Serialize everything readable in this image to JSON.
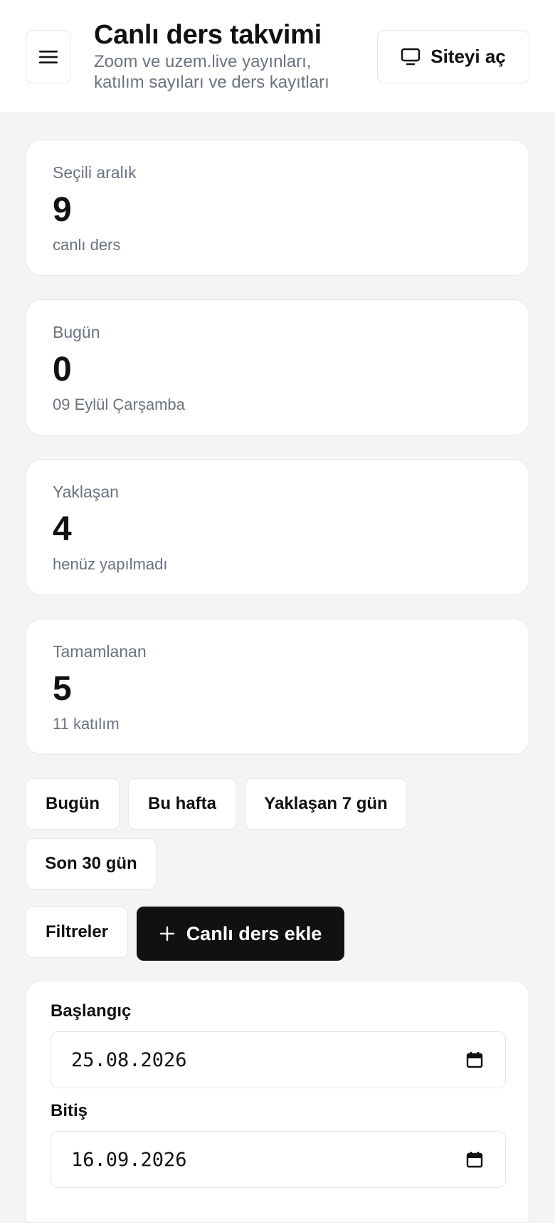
{
  "header": {
    "title": "Canlı ders takvimi",
    "subtitle": "Zoom ve uzem.live yayınları, katılım sayıları ve ders kayıtları",
    "site_button": "Siteyi aç",
    "menu_icon": "hamburger-icon",
    "site_icon": "monitor-icon"
  },
  "stats": [
    {
      "label": "Seçili aralık",
      "value": "9",
      "sub": "canlı ders"
    },
    {
      "label": "Bugün",
      "value": "0",
      "sub": "09 Eylül Çarşamba"
    },
    {
      "label": "Yaklaşan",
      "value": "4",
      "sub": "henüz yapılmadı"
    },
    {
      "label": "Tamamlanan",
      "value": "5",
      "sub": "11 katılım"
    }
  ],
  "quick_ranges": [
    "Bugün",
    "Bu hafta",
    "Yaklaşan 7 gün",
    "Son 30 gün"
  ],
  "actions": {
    "filters": "Filtreler",
    "add": "Canlı ders ekle",
    "add_icon": "plus-icon"
  },
  "filters": {
    "start_label": "Başlangıç",
    "start_value": "25.08.2026",
    "end_label": "Bitiş",
    "end_value": "16.09.2026",
    "calendar_icon": "calendar-icon"
  },
  "colors": {
    "background": "#f3f4f6",
    "card": "#ffffff",
    "border": "#e5e7eb",
    "muted_text": "#6b7280",
    "primary": "#111111"
  }
}
